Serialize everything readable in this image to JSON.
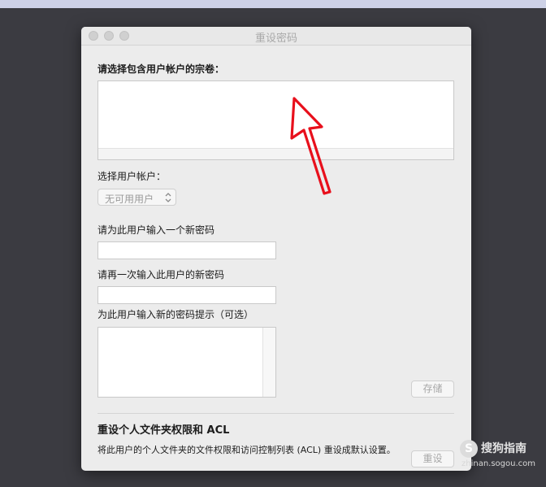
{
  "window": {
    "title": "重设密码"
  },
  "volume_section": {
    "label": "请选择包含用户帐户的宗卷："
  },
  "account_section": {
    "label": "选择用户帐户：",
    "popup_value": "无可用用户"
  },
  "password_section": {
    "new_password_label": "请为此用户输入一个新密码",
    "new_password_value": "",
    "confirm_label": "请再一次输入此用户的新密码",
    "confirm_value": "",
    "hint_label": "为此用户输入新的密码提示（可选）",
    "hint_value": ""
  },
  "buttons": {
    "save": "存储",
    "reset": "重设"
  },
  "acl_section": {
    "title": "重设个人文件夹权限和 ACL",
    "description": "将此用户的个人文件夹的文件权限和访问控制列表 (ACL) 重设成默认设置。"
  },
  "annotation": {
    "arrow_color": "#e8101c"
  },
  "watermark": {
    "icon_glyph": "S",
    "brand": "搜狗指南",
    "url": "zhinan.sogou.com"
  }
}
